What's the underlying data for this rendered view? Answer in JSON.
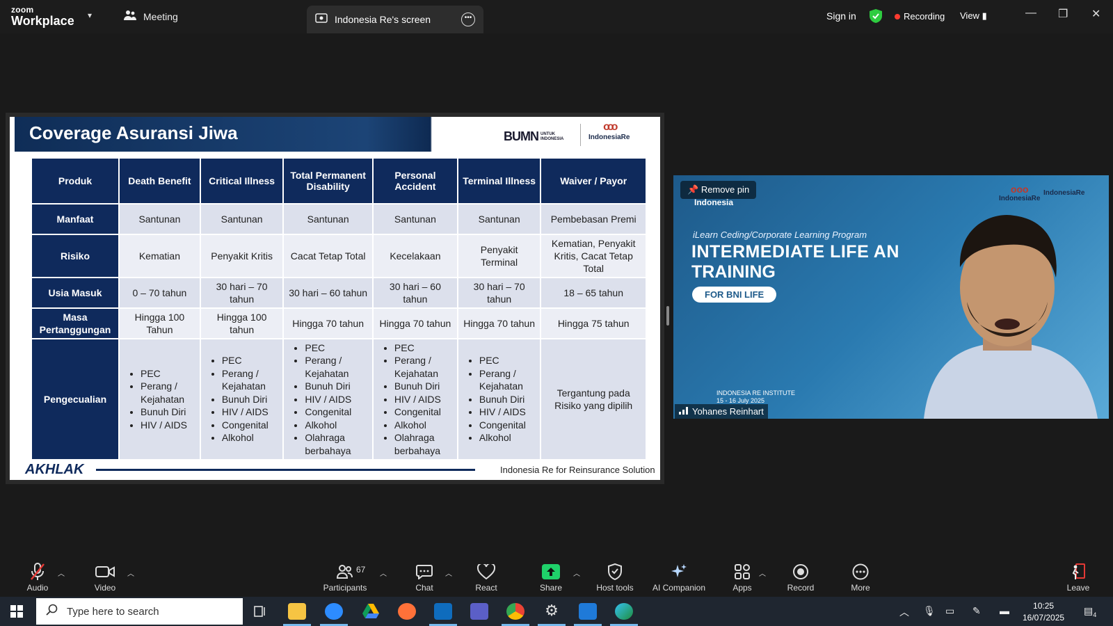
{
  "topbar": {
    "brand_line1": "zoom",
    "brand_line2": "Workplace",
    "meeting_tab": "Meeting",
    "share_tab": "Indonesia Re's screen",
    "sign_in": "Sign in",
    "recording": "Recording",
    "view": "View"
  },
  "slide": {
    "title": "Coverage Asuransi Jiwa",
    "logo_bumn": "BUMN",
    "logo_bumn_sub": "UNTUK INDONESIA",
    "logo_ire": "IndonesiaRe",
    "headers": [
      "Produk",
      "Death Benefit",
      "Critical Illness",
      "Total Permanent Disability",
      "Personal Accident",
      "Terminal Illness",
      "Waiver / Payor"
    ],
    "rows": [
      {
        "label": "Manfaat",
        "cells": [
          "Santunan",
          "Santunan",
          "Santunan",
          "Santunan",
          "Santunan",
          "Pembebasan Premi"
        ]
      },
      {
        "label": "Risiko",
        "cells": [
          "Kematian",
          "Penyakit Kritis",
          "Cacat Tetap Total",
          "Kecelakaan",
          "Penyakit Terminal",
          "Kematian, Penyakit Kritis, Cacat Tetap Total"
        ]
      },
      {
        "label": "Usia Masuk",
        "cells": [
          "0 – 70 tahun",
          "30 hari – 70 tahun",
          "30 hari – 60 tahun",
          "30 hari – 60 tahun",
          "30 hari – 70 tahun",
          "18 – 65 tahun"
        ]
      },
      {
        "label": "Masa Pertanggungan",
        "cells": [
          "Hingga 100 Tahun",
          "Hingga 100 tahun",
          "Hingga 70 tahun",
          "Hingga 70 tahun",
          "Hingga 70 tahun",
          "Hingga 75 tahun"
        ]
      }
    ],
    "exclusion_label": "Pengecualian",
    "exclusions": [
      [
        "PEC",
        "Perang / Kejahatan",
        "Bunuh Diri",
        "HIV / AIDS"
      ],
      [
        "PEC",
        "Perang / Kejahatan",
        "Bunuh Diri",
        "HIV / AIDS",
        "Congenital",
        "Alkohol"
      ],
      [
        "PEC",
        "Perang / Kejahatan",
        "Bunuh Diri",
        "HIV / AIDS",
        "Congenital",
        "Alkohol",
        "Olahraga berbahaya"
      ],
      [
        "PEC",
        "Perang / Kejahatan",
        "Bunuh Diri",
        "HIV / AIDS",
        "Congenital",
        "Alkohol",
        "Olahraga berbahaya"
      ],
      [
        "PEC",
        "Perang / Kejahatan",
        "Bunuh Diri",
        "HIV / AIDS",
        "Congenital",
        "Alkohol"
      ]
    ],
    "exclusion_last": "Tergantung pada Risiko yang dipilih",
    "footer_logo": "AKHLAK",
    "footer_text": "Indonesia Re for Reinsurance Solution"
  },
  "video": {
    "remove_pin": "Remove pin",
    "bg_indonesia": "Indonesia",
    "bg_subtitle": "iLearn Ceding/Corporate Learning Program",
    "bg_title1": "INTERMEDIATE LIFE AN",
    "bg_title2": "TRAINING",
    "bg_badge": "FOR BNI LIFE",
    "bg_institute": "INDONESIA RE INSTITUTE",
    "bg_dates": "15 - 16 July 2025",
    "bg_logo1": "IndonesiaRe",
    "bg_logo2": "IndonesiaRe",
    "participant_name": "Yohanes Reinhart"
  },
  "toolbar": {
    "audio": "Audio",
    "video": "Video",
    "participants": "Participants",
    "participant_count": "67",
    "chat": "Chat",
    "react": "React",
    "share": "Share",
    "host_tools": "Host tools",
    "ai_companion": "AI Companion",
    "apps": "Apps",
    "record": "Record",
    "more": "More",
    "leave": "Leave"
  },
  "taskbar": {
    "search_placeholder": "Type here to search",
    "time": "10:25",
    "date": "16/07/2025",
    "notifications": "4"
  },
  "colors": {
    "slide_navy": "#0f2a5c",
    "recording_red": "#ff3b30",
    "shield_green": "#2ecc40",
    "share_green": "#1fd16a"
  }
}
